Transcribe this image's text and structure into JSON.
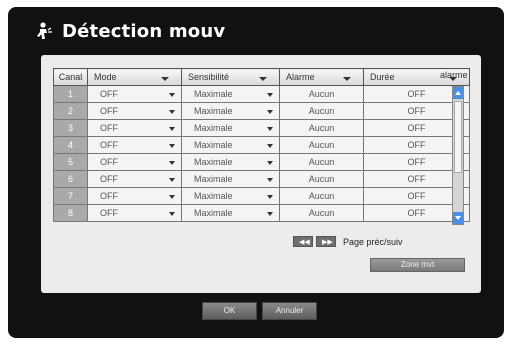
{
  "window": {
    "title": "Détection mouv"
  },
  "table": {
    "headers": [
      "Canal",
      "Mode",
      "Sensibilité",
      "Alarme",
      "Durée"
    ],
    "overflow_header": "alarme",
    "rows": [
      {
        "canal": "1",
        "mode": "OFF",
        "sensibilite": "Maximale",
        "alarme": "Aucun",
        "duree": "OFF"
      },
      {
        "canal": "2",
        "mode": "OFF",
        "sensibilite": "Maximale",
        "alarme": "Aucun",
        "duree": "OFF"
      },
      {
        "canal": "3",
        "mode": "OFF",
        "sensibilite": "Maximale",
        "alarme": "Aucun",
        "duree": "OFF"
      },
      {
        "canal": "4",
        "mode": "OFF",
        "sensibilite": "Maximale",
        "alarme": "Aucun",
        "duree": "OFF"
      },
      {
        "canal": "5",
        "mode": "OFF",
        "sensibilite": "Maximale",
        "alarme": "Aucun",
        "duree": "OFF"
      },
      {
        "canal": "6",
        "mode": "OFF",
        "sensibilite": "Maximale",
        "alarme": "Aucun",
        "duree": "OFF"
      },
      {
        "canal": "7",
        "mode": "OFF",
        "sensibilite": "Maximale",
        "alarme": "Aucun",
        "duree": "OFF"
      },
      {
        "canal": "8",
        "mode": "OFF",
        "sensibilite": "Maximale",
        "alarme": "Aucun",
        "duree": "OFF"
      }
    ]
  },
  "pager": {
    "label": "Page préc/suiv"
  },
  "buttons": {
    "zone": "Zone mvt",
    "ok": "OK",
    "cancel": "Annuler"
  },
  "icons": {
    "title": "motion-person-icon",
    "prev": "rewind-icon",
    "next": "fast-forward-icon"
  },
  "colors": {
    "frame": "#111111",
    "panel": "#ececec",
    "scroll_accent": "#4a8ee0"
  }
}
